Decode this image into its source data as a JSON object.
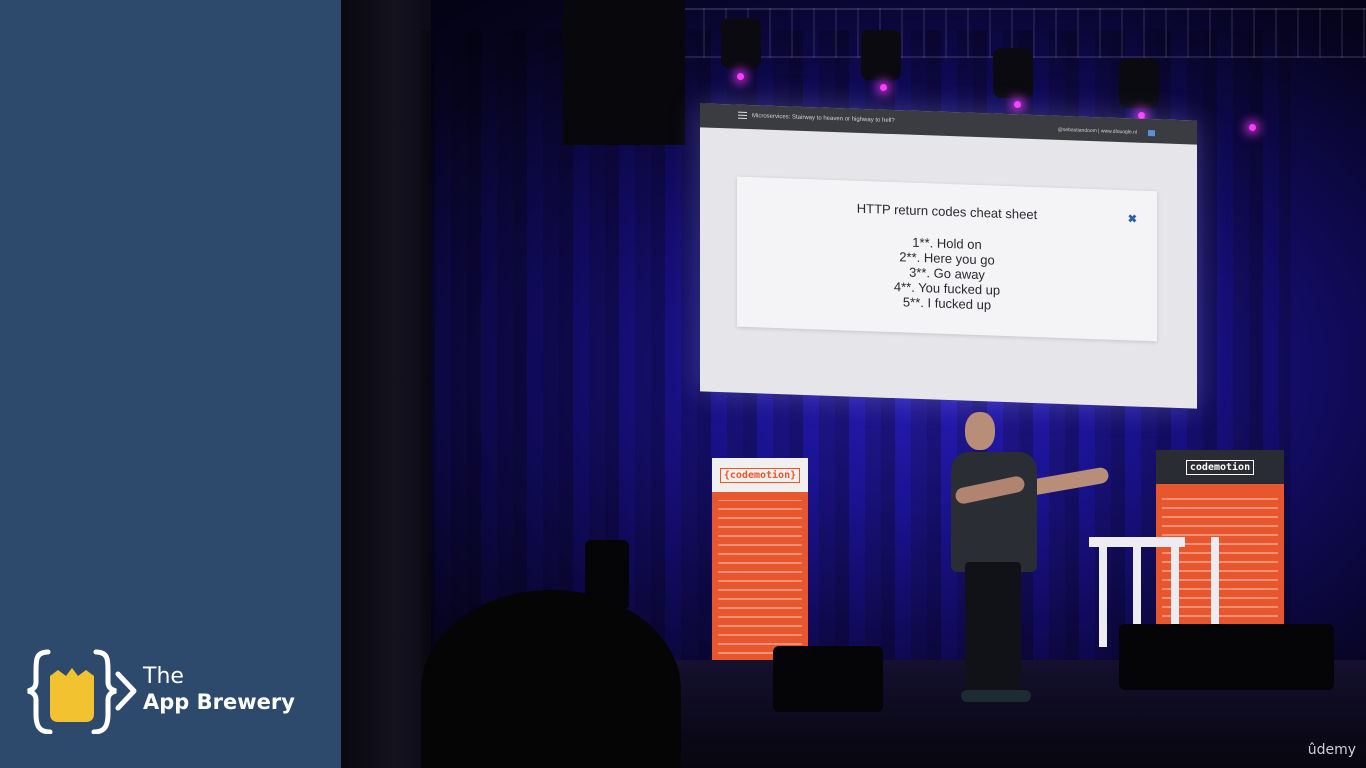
{
  "brand": {
    "the": "The",
    "name": "App Brewery",
    "logo_icon": "curly-braces-mug-logo",
    "panel_color": "#2d4a6d",
    "accent_color": "#f2c230"
  },
  "slide": {
    "header_title": "Microservices: Stairway to heaven or highway to hell?",
    "header_handle": "@sebastiandoom | www.dlouogle.nl",
    "card_heading": "HTTP return codes cheat sheet",
    "close_glyph": "✖",
    "lines": [
      "1**. Hold on",
      "2**. Here you go",
      "3**. Go away",
      "4**. You fucked up",
      "5**. I fucked up"
    ]
  },
  "banners": {
    "left_logo": "{codemotion}",
    "right_logo": "codemotion",
    "color": "#e8562e"
  },
  "watermark": {
    "label": "ûdemy"
  }
}
